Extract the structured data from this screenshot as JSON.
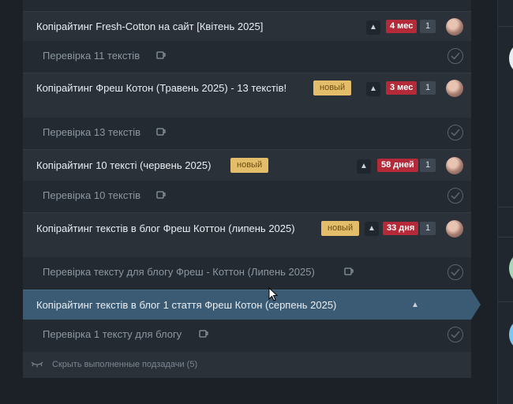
{
  "tasks": [
    {
      "title": "Копірайтинг Fresh-Cotton на сайт [Квітень 2025]",
      "new_badge": "",
      "due": "4 мес",
      "count": "1"
    },
    {
      "title": "Копірайтинг Фреш Котон (Травень 2025) - 13 текстів!",
      "new_badge": "новый",
      "due": "3 мес",
      "count": "1"
    },
    {
      "title": "Копірайтинг 10 тексті (червень 2025)",
      "new_badge": "новый",
      "due": "58 дней",
      "count": "1"
    },
    {
      "title": "Копірайтинг текстів в блог Фреш Коттон (липень 2025)",
      "new_badge": "новый",
      "due": "33 дня",
      "count": "1"
    },
    {
      "title": "Копірайтинг текстів в блог 1 стаття Фреш Котон (серпень 2025)",
      "new_badge": "",
      "due": "",
      "count": ""
    }
  ],
  "subtasks": [
    "Перевірка 11 текстів",
    "Перевірка 13 текстів",
    "Перевірка 10 текстів",
    "Перевірка тексту для блогу Фреш - Коттон (Липень 2025)",
    "Перевірка 1 тексту для блогу"
  ],
  "footer": {
    "hide_completed_label": "Скрыть выполненные подзадачи (5)"
  },
  "icons": {
    "expand": "chevron-up-icon",
    "subtask": "cup-icon",
    "complete": "check-circle-icon",
    "toggle": "eye-closed-icon"
  },
  "colors": {
    "active": "#3b5a73",
    "due_badge": "#b52a38",
    "new_badge": "#e3bd6a"
  }
}
